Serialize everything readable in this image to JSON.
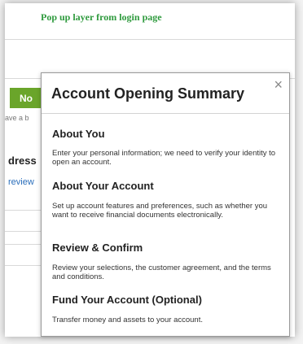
{
  "caption": "Pop up layer from login page",
  "background": {
    "no_button": "No",
    "small_text": "ave a b",
    "section_heading": "dress",
    "link": "review"
  },
  "modal": {
    "title": "Account Opening Summary",
    "close_glyph": "×",
    "sections": [
      {
        "heading": "About You",
        "text": "Enter your personal information; we need to verify your identity to open an account."
      },
      {
        "heading": "About Your Account",
        "text": "Set up account features and preferences, such as whether you want to receive financial documents electronically."
      },
      {
        "heading": "Review & Confirm",
        "text": "Review your selections, the customer agreement, and the terms and conditions."
      },
      {
        "heading": "Fund Your Account (Optional)",
        "text": "Transfer money and assets to your account."
      }
    ]
  },
  "colors": {
    "caption": "#2e9a3d",
    "no_button": "#6aa52a",
    "link": "#2a6ebb"
  }
}
